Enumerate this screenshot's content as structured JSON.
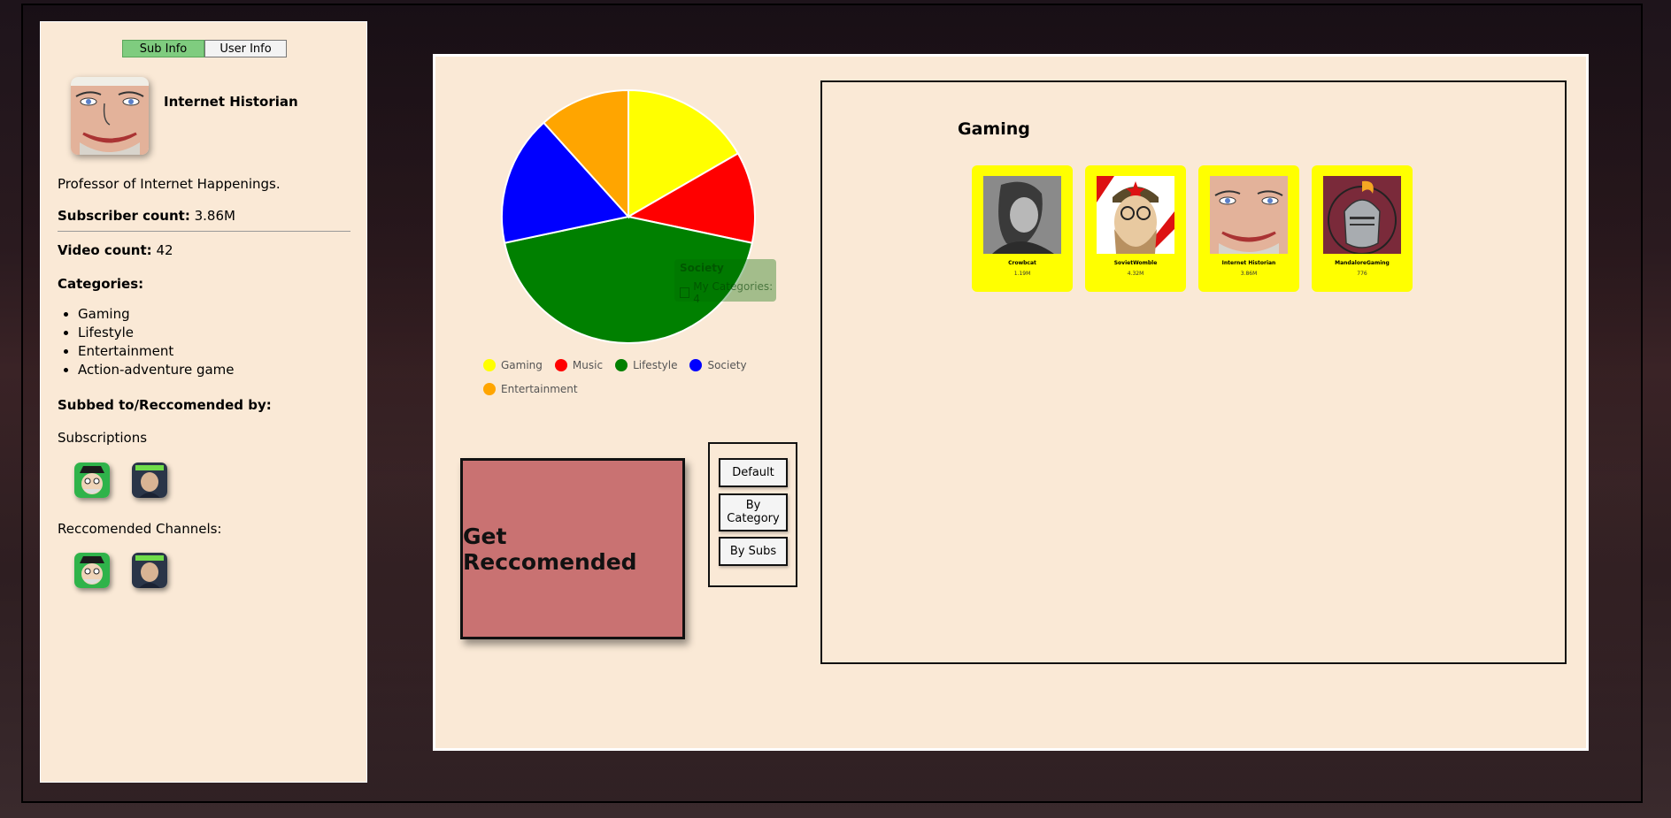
{
  "sidebar": {
    "tabs": [
      {
        "label": "Sub Info",
        "active": true
      },
      {
        "label": "User Info",
        "active": false
      }
    ],
    "channel_name": "Internet Historian",
    "description": "Professor of Internet Happenings.",
    "subscriber_label": "Subscriber count:",
    "subscriber_value": "3.86M",
    "video_label": "Video count:",
    "video_value": "42",
    "categories_heading": "Categories:",
    "categories": [
      "Gaming",
      "Lifestyle",
      "Entertainment",
      "Action-adventure game"
    ],
    "subbed_heading": "Subbed to/Reccomended by:",
    "subscriptions_label": "Subscriptions",
    "recommended_label": "Reccomended Channels:"
  },
  "chart_data": {
    "type": "pie",
    "categories": [
      "Gaming",
      "Music",
      "Lifestyle",
      "Society",
      "Entertainment"
    ],
    "values": [
      1,
      0.7,
      2.6,
      1,
      0.7
    ],
    "colors": [
      "#ffff00",
      "#ff0000",
      "#008000",
      "#0000ff",
      "#ffa500"
    ],
    "legend_position": "bottom",
    "tooltip": {
      "title": "Society",
      "label": "My Categories: 4"
    }
  },
  "actions": {
    "get_recommended": "Get Reccomended",
    "modes": [
      "Default",
      "By Category",
      "By Subs"
    ]
  },
  "results": {
    "title": "Gaming",
    "cards": [
      {
        "name": "Crowbcat",
        "subs": "1.19M"
      },
      {
        "name": "SovietWomble",
        "subs": "4.32M"
      },
      {
        "name": "Internet Historian",
        "subs": "3.86M"
      },
      {
        "name": "MandaloreGaming",
        "subs": "776"
      }
    ]
  }
}
